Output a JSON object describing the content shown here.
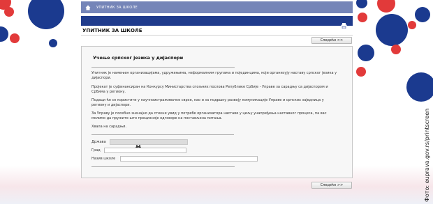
{
  "topbar": {
    "title": "УПИТНИК ЗА ШКОЛЕ"
  },
  "page": {
    "heading": "УПИТНИК ЗА ШКОЛЕ"
  },
  "nav": {
    "next_label": "Следеће >>"
  },
  "card": {
    "title": "Учење српског језика у дијаспори",
    "paragraphs": [
      "Упитник је намењен организацијама, удружењима, неформалним групама и појединцима, који организују наставу српског језика у дијаспори.",
      "Пројекат је суфинансиран на Конкурсу Министарства спољних послова Републике Србије - Управе за сарадњу са дијаспором и Србима у региону.",
      "Подаци ће се користити у научноистраживачке сврхе, као и за подршку развоју комуникације Управе и српских заједница у региону и дијаспори.",
      "За Управу је посебно значајно да стекне увид у потребе организатора наставе у циљу унапређења наставног процеса, па вас молимо да пружите што прецизније одговоре на постављена питања.",
      "Хвала на сарадњи."
    ],
    "fields": {
      "country_label": "Држава",
      "city_label": "Град",
      "school_label": "Назив школе"
    }
  },
  "credit": "Фото: eupravа.gov.rs/printscreen",
  "colors": {
    "brand_blue": "#1f3b8c",
    "topbar": "#7585b8",
    "accent_red": "#e23a3a"
  },
  "icons": [
    "home-icon",
    "print-icon",
    "binoculars-icon"
  ]
}
